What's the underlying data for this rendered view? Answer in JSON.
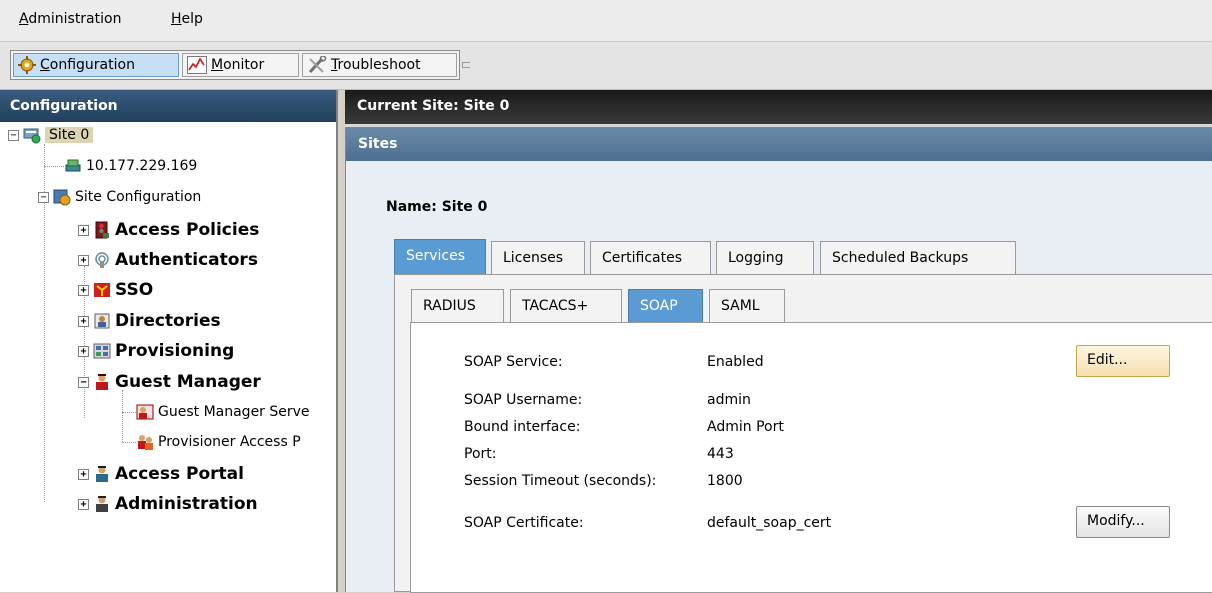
{
  "menubar": {
    "items": [
      {
        "label_ul": "A",
        "label_rest": "dministration"
      },
      {
        "label_ul": "H",
        "label_rest": "elp"
      }
    ]
  },
  "toolbar": {
    "configuration": {
      "ul": "C",
      "rest": "onfiguration"
    },
    "monitor": {
      "ul": "M",
      "rest": "onitor"
    },
    "troubleshoot": {
      "ul": "T",
      "rest": "roubleshoot"
    }
  },
  "left_panel": {
    "title": "Configuration",
    "tree": {
      "site": "Site 0",
      "ip": "10.177.229.169",
      "site_config": "Site Configuration",
      "access_policies": "Access Policies",
      "authenticators": "Authenticators",
      "sso": "SSO",
      "directories": "Directories",
      "provisioning": "Provisioning",
      "guest_manager": "Guest Manager",
      "guest_manager_serve": "Guest Manager Serve",
      "provisioner_access": "Provisioner Access P",
      "access_portal": "Access Portal",
      "administration": "Administration"
    }
  },
  "current_site": "Current Site:  Site 0",
  "sites_header": "Sites",
  "name_line": "Name:  Site 0",
  "tabs": [
    "Services",
    "Licenses",
    "Certificates",
    "Logging",
    "Scheduled Backups"
  ],
  "subtabs": [
    "RADIUS",
    "TACACS+",
    "SOAP",
    "SAML"
  ],
  "soap": {
    "service_label": "SOAP Service:",
    "service_value": "Enabled",
    "username_label": "SOAP Username:",
    "username_value": "admin",
    "bound_label": "Bound interface:",
    "bound_value": "Admin Port",
    "port_label": "Port:",
    "port_value": "443",
    "timeout_label": "Session Timeout (seconds):",
    "timeout_value": "1800",
    "cert_label": "SOAP Certificate:",
    "cert_value": "default_soap_cert",
    "edit_button": "Edit...",
    "modify_button": "Modify..."
  },
  "colors": {
    "active_tab": "#5a9bd3",
    "panel_header": "#2a4a6a",
    "sites_header": "#5a7a9a"
  }
}
